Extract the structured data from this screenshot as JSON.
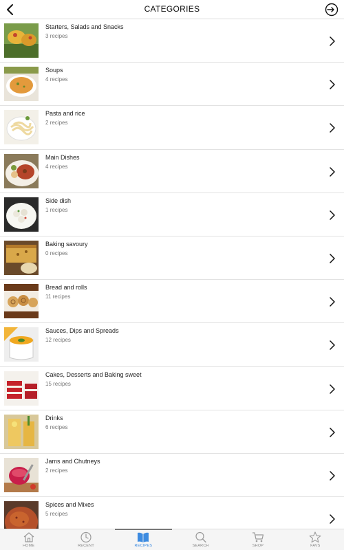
{
  "header": {
    "title": "CATEGORIES"
  },
  "categories": [
    {
      "name": "Starters, Salads and Snacks",
      "count": "3 recipes"
    },
    {
      "name": "Soups",
      "count": "4 recipes"
    },
    {
      "name": "Pasta and rice",
      "count": "2 recipes"
    },
    {
      "name": "Main Dishes",
      "count": "4 recipes"
    },
    {
      "name": "Side dish",
      "count": "1 recipes"
    },
    {
      "name": "Baking savoury",
      "count": "0 recipes"
    },
    {
      "name": "Bread and rolls",
      "count": "11 recipes"
    },
    {
      "name": "Sauces, Dips and Spreads",
      "count": "12 recipes"
    },
    {
      "name": "Cakes, Desserts and Baking sweet",
      "count": "15 recipes"
    },
    {
      "name": "Drinks",
      "count": "6 recipes"
    },
    {
      "name": "Jams and Chutneys",
      "count": "2 recipes"
    },
    {
      "name": "Spices and Mixes",
      "count": "5 recipes"
    }
  ],
  "tabs": [
    {
      "label": "HOME",
      "icon": "home-icon"
    },
    {
      "label": "RECENT",
      "icon": "clock-icon"
    },
    {
      "label": "RECIPES",
      "icon": "book-icon",
      "active": true
    },
    {
      "label": "SEARCH",
      "icon": "search-icon"
    },
    {
      "label": "SHOP",
      "icon": "cart-icon"
    },
    {
      "label": "FAVS",
      "icon": "star-icon"
    }
  ],
  "colors": {
    "accent": "#3d8be0",
    "divider": "#e2e2e2",
    "tab_inactive": "#8a8a8a"
  }
}
